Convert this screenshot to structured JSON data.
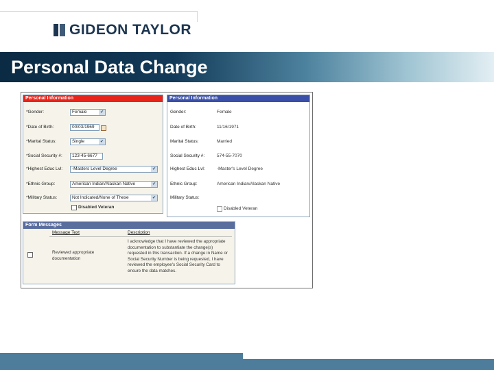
{
  "brand": {
    "name": "GIDEON TAYLOR"
  },
  "slide": {
    "title": "Personal Data Change"
  },
  "colors": {
    "title_dark": "#0b2a43",
    "title_light": "#9ec3d2",
    "footer": "#4d7d9b",
    "panel_red": "#e8231a",
    "panel_blue": "#3a4fa8",
    "messages_header": "#5a6e9e"
  },
  "left_panel": {
    "header": "Personal Information",
    "fields": [
      {
        "label": "*Gender:",
        "value": "Female",
        "control": "dropdown"
      },
      {
        "label": "*Date of Birth:",
        "value": "00/03/1969",
        "control": "date"
      },
      {
        "label": "*Marital Status:",
        "value": "Single",
        "control": "dropdown"
      },
      {
        "label": "*Social Security #:",
        "value": "123-45-6677",
        "control": "text"
      },
      {
        "label": "*Highest Educ Lvl:",
        "value": "-Masters Level Degree",
        "control": "dropdown"
      },
      {
        "label": "*Ethnic Group:",
        "value": "American Indian/Alaskan Native",
        "control": "dropdown"
      },
      {
        "label": "*Military Status:",
        "value": "Not Indicated/None of These",
        "control": "dropdown"
      }
    ],
    "disabled_veteran": "Disabled Veteran"
  },
  "right_panel": {
    "header": "Personal Information",
    "fields": [
      {
        "label": "Gender:",
        "value": "Female"
      },
      {
        "label": "Date of Birth:",
        "value": "11/16/1971"
      },
      {
        "label": "Marital Status:",
        "value": "Married"
      },
      {
        "label": "Social Security #:",
        "value": "574-55-7070"
      },
      {
        "label": "Highest Educ Lvl:",
        "value": "-Master's Level Degree"
      },
      {
        "label": "Ethnic Group:",
        "value": "American Indian/Alaskan Native"
      },
      {
        "label": "Military Status:",
        "value": ""
      }
    ],
    "disabled_veteran": "Disabled Veteran"
  },
  "form_messages": {
    "header": "Form Messages",
    "columns": [
      "Message Text",
      "Description"
    ],
    "rows": [
      {
        "message": "Reviewed appropriate documentation",
        "description": "I acknowledge that I have reviewed the appropriate documentation to substantiate the change(s) requested in this transaction. If a change in Name or Social Security Number is being requested, I have reviewed the employee's Social Security Card to ensure the data matches."
      }
    ]
  }
}
